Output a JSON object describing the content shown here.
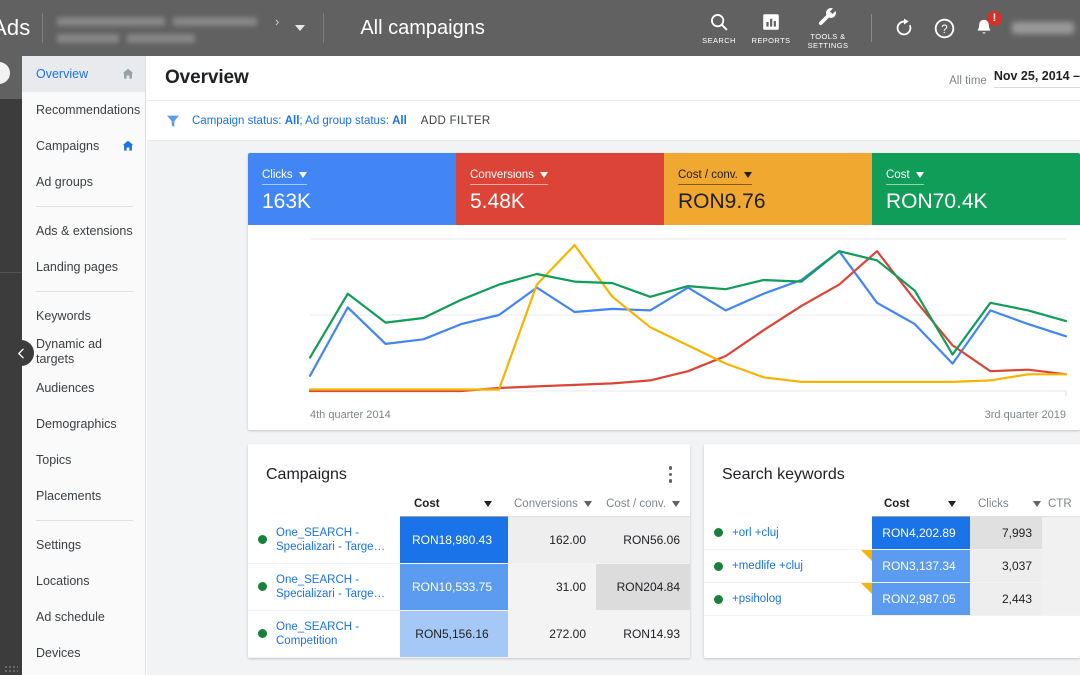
{
  "topbar": {
    "brand": "Ads",
    "page_title": "All campaigns",
    "items": [
      {
        "label": "SEARCH",
        "icon": "search-icon"
      },
      {
        "label": "REPORTS",
        "icon": "reports-bar-chart-icon"
      },
      {
        "label": "TOOLS & SETTINGS",
        "icon": "wrench-icon"
      }
    ],
    "refresh_icon": "refresh-icon",
    "help_icon": "help-circle-icon",
    "notifications_icon": "notification-bell-icon",
    "notification_badge": "!"
  },
  "sidebar": {
    "items": [
      {
        "label": "Overview",
        "active": true,
        "home": "gray"
      },
      {
        "label": "Recommendations",
        "active": false,
        "home": null
      },
      {
        "label": "Campaigns",
        "active": false,
        "home": "blue"
      },
      {
        "label": "Ad groups",
        "active": false,
        "home": null,
        "divider_after": true
      },
      {
        "label": "Ads & extensions",
        "active": false,
        "home": null
      },
      {
        "label": "Landing pages",
        "active": false,
        "home": null,
        "divider_after": true
      },
      {
        "label": "Keywords",
        "active": false,
        "home": null
      },
      {
        "label": "Dynamic ad targets",
        "active": false,
        "home": null
      },
      {
        "label": "Audiences",
        "active": false,
        "home": null
      },
      {
        "label": "Demographics",
        "active": false,
        "home": null
      },
      {
        "label": "Topics",
        "active": false,
        "home": null
      },
      {
        "label": "Placements",
        "active": false,
        "home": null,
        "divider_after": true
      },
      {
        "label": "Settings",
        "active": false,
        "home": null
      },
      {
        "label": "Locations",
        "active": false,
        "home": null
      },
      {
        "label": "Ad schedule",
        "active": false,
        "home": null
      },
      {
        "label": "Devices",
        "active": false,
        "home": null
      }
    ]
  },
  "page": {
    "title": "Overview",
    "date_label": "All time",
    "date_value": "Nov 25, 2014 –"
  },
  "filterbar": {
    "icon": "filter-funnel-icon",
    "chip_prefix": "Campaign status: ",
    "chip_value_1": "All",
    "chip_middle": "; Ad group status: ",
    "chip_value_2": "All",
    "add_filter": "ADD FILTER"
  },
  "scorecards": [
    {
      "label": "Clicks",
      "value": "163K",
      "color": "#4285f4",
      "text": "light"
    },
    {
      "label": "Conversions",
      "value": "5.48K",
      "color": "#db4437",
      "text": "light"
    },
    {
      "label": "Cost / conv.",
      "value": "RON9.76",
      "color": "#f0a830",
      "text": "dark"
    },
    {
      "label": "Cost",
      "value": "RON70.4K",
      "color": "#0f9d58",
      "text": "light"
    }
  ],
  "chart_data": {
    "type": "line",
    "title": "",
    "xlabel": "",
    "ylabel": "",
    "grid": true,
    "legend": "none",
    "x_tick_labels": [
      "4th quarter 2014",
      "3rd quarter 2019"
    ],
    "x_start": "4th quarter 2014",
    "x_end": "3rd quarter 2019",
    "x_count": 21,
    "ylim": [
      0,
      100
    ],
    "series": [
      {
        "name": "Clicks",
        "color": "#4285f4",
        "values": [
          10,
          55,
          31,
          34,
          44,
          50,
          68,
          52,
          54,
          53,
          68,
          53,
          64,
          73,
          92,
          58,
          44,
          18,
          53,
          44,
          36
        ]
      },
      {
        "name": "Conversions",
        "color": "#db4437",
        "values": [
          0,
          0,
          0,
          0,
          0,
          2,
          3,
          4,
          5,
          7,
          13,
          23,
          40,
          56,
          70,
          92,
          60,
          30,
          13,
          14,
          11
        ]
      },
      {
        "name": "Cost / conv.",
        "color": "#f4b400",
        "values": [
          1,
          1,
          1,
          1,
          1,
          1,
          70,
          96,
          62,
          42,
          30,
          18,
          9,
          6,
          6,
          6,
          6,
          6,
          7,
          11,
          11
        ]
      },
      {
        "name": "Cost",
        "color": "#0f9d58",
        "values": [
          22,
          64,
          45,
          48,
          60,
          70,
          77,
          72,
          71,
          62,
          69,
          67,
          73,
          72,
          92,
          86,
          66,
          24,
          58,
          53,
          46
        ]
      }
    ]
  },
  "campaigns_panel": {
    "title": "Campaigns",
    "menu_icon": "kebab-menu-icon",
    "columns": [
      "",
      "Cost",
      "Conversions",
      "Cost / conv."
    ],
    "sorted_column": "Cost",
    "rows": [
      {
        "status": "enabled",
        "name": "One_SEARCH - Specializari - Targe…",
        "cost": "RON18,980.43",
        "conversions": "162.00",
        "cost_per_conv": "RON56.06"
      },
      {
        "status": "enabled",
        "name": "One_SEARCH - Specializari - Targe…",
        "cost": "RON10,533.75",
        "conversions": "31.00",
        "cost_per_conv": "RON204.84"
      },
      {
        "status": "enabled",
        "name": "One_SEARCH - Competition",
        "cost": "RON5,156.16",
        "conversions": "272.00",
        "cost_per_conv": "RON14.93"
      }
    ]
  },
  "keywords_panel": {
    "title": "Search keywords",
    "columns": [
      "",
      "Cost",
      "Clicks",
      "CTR"
    ],
    "sorted_column": "Cost",
    "rows": [
      {
        "status": "enabled",
        "name": "+orl +cluj",
        "cost": "RON4,202.89",
        "clicks": "7,993",
        "ctr": "",
        "flag": false
      },
      {
        "status": "enabled",
        "name": "+medlife +cluj",
        "cost": "RON3,137.34",
        "clicks": "3,037",
        "ctr": "",
        "flag": true
      },
      {
        "status": "enabled",
        "name": "+psiholog",
        "cost": "RON2,987.05",
        "clicks": "2,443",
        "ctr": "",
        "flag": true
      }
    ]
  }
}
